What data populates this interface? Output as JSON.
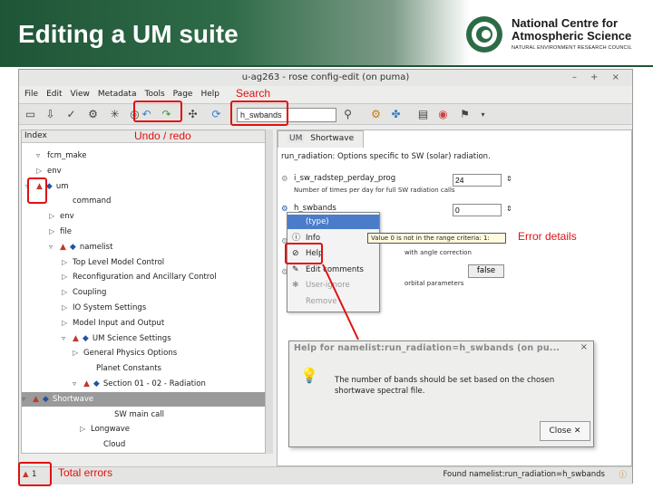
{
  "slide": {
    "title": "Editing a UM suite",
    "logo": {
      "line1": "National Centre for",
      "line2": "Atmospheric Science",
      "line3": "NATURAL ENVIRONMENT RESEARCH COUNCIL"
    }
  },
  "window": {
    "title": "u-ag263 - rose config-edit (on puma)",
    "controls": "– + ×",
    "menu": [
      "File",
      "Edit",
      "View",
      "Metadata",
      "Tools",
      "Page",
      "Help"
    ]
  },
  "toolbar": {
    "search_value": "h_swbands"
  },
  "tree": {
    "header": "Index",
    "rows": [
      {
        "label": "fcm_make",
        "expander": "▿",
        "warn": false,
        "mod": false,
        "selected": false
      },
      {
        "label": "env",
        "expander": "▷",
        "warn": false,
        "mod": false,
        "selected": false
      },
      {
        "label": "um",
        "expander": "▿",
        "warn": true,
        "mod": true,
        "selected": false
      },
      {
        "label": "command",
        "expander": "",
        "warn": false,
        "mod": false,
        "selected": false
      },
      {
        "label": "env",
        "expander": "▷",
        "warn": false,
        "mod": false,
        "selected": false
      },
      {
        "label": "file",
        "expander": "▷",
        "warn": false,
        "mod": false,
        "selected": false
      },
      {
        "label": "namelist",
        "expander": "▿",
        "warn": true,
        "mod": true,
        "selected": false
      },
      {
        "label": "Top Level Model Control",
        "expander": "▷",
        "warn": false,
        "mod": false,
        "selected": false
      },
      {
        "label": "Reconfiguration and Ancillary Control",
        "expander": "▷",
        "warn": false,
        "mod": false,
        "selected": false
      },
      {
        "label": "Coupling",
        "expander": "▷",
        "warn": false,
        "mod": false,
        "selected": false
      },
      {
        "label": "IO System Settings",
        "expander": "▷",
        "warn": false,
        "mod": false,
        "selected": false
      },
      {
        "label": "Model Input and Output",
        "expander": "▷",
        "warn": false,
        "mod": false,
        "selected": false
      },
      {
        "label": "UM Science Settings",
        "expander": "▿",
        "warn": true,
        "mod": true,
        "selected": false
      },
      {
        "label": "General Physics Options",
        "expander": "▷",
        "warn": false,
        "mod": false,
        "selected": false
      },
      {
        "label": "Planet Constants",
        "expander": "",
        "warn": false,
        "mod": false,
        "selected": false
      },
      {
        "label": "Section 01 - 02 - Radiation",
        "expander": "▿",
        "warn": true,
        "mod": true,
        "selected": false
      },
      {
        "label": "Shortwave",
        "expander": "▿",
        "warn": true,
        "mod": true,
        "selected": true
      },
      {
        "label": "SW main call",
        "expander": "",
        "warn": false,
        "mod": false,
        "selected": false
      },
      {
        "label": "Longwave",
        "expander": "▷",
        "warn": false,
        "mod": false,
        "selected": false
      },
      {
        "label": "Cloud",
        "expander": "",
        "warn": false,
        "mod": false,
        "selected": false
      }
    ]
  },
  "tab": {
    "badge": "UM",
    "label": "Shortwave"
  },
  "panel": {
    "section_desc": "run_radiation: Options specific to SW (solar) radiation.",
    "var1": {
      "name": "i_sw_radstep_perday_prog",
      "desc": "Number of times per day for full SW radiation calls",
      "value": "24"
    },
    "var2": {
      "name": "h_swbands",
      "value": "0"
    },
    "var3_clip": "with angle correction",
    "var4_clip": "orbital parameters",
    "toggle": "false"
  },
  "context_menu": {
    "items": [
      {
        "label": "(type)",
        "icon": "",
        "highlight": true,
        "disabled": false
      },
      {
        "label": "Info",
        "icon": "ⓘ",
        "highlight": false,
        "disabled": false
      },
      {
        "label": "Help",
        "icon": "⊘",
        "highlight": false,
        "disabled": false
      },
      {
        "label": "Edit comments",
        "icon": "✎",
        "highlight": false,
        "disabled": false
      },
      {
        "label": "User-ignore",
        "icon": "✱",
        "highlight": false,
        "disabled": true
      },
      {
        "label": "Remove",
        "icon": "",
        "highlight": false,
        "disabled": true
      }
    ]
  },
  "tooltip": {
    "text": "Value 0 is not in the range criteria: 1:"
  },
  "help_dialog": {
    "title": "Help for namelist:run_radiation=h_swbands (on pu...",
    "body": "The number of bands should be set based on the chosen shortwave spectral file.",
    "close_label": "Close"
  },
  "status": {
    "error_count": "1",
    "found": "Found namelist:run_radiation=h_swbands"
  },
  "annotations": {
    "search": "Search",
    "undo_redo": "Undo / redo",
    "error_details": "Error details",
    "total_errors": "Total errors"
  }
}
